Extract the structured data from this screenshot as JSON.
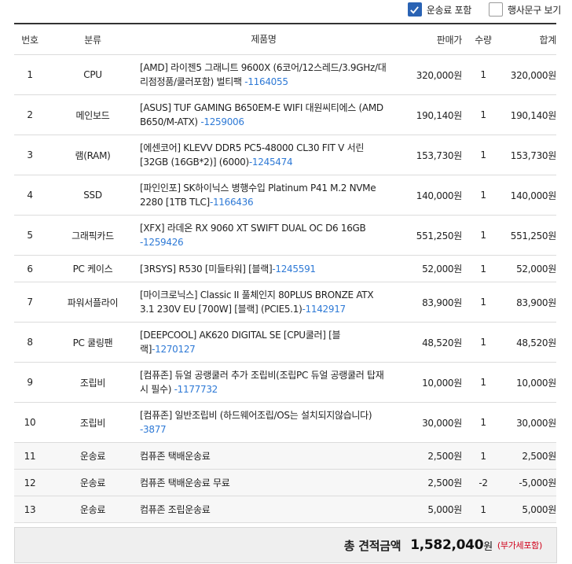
{
  "options": {
    "shipping": {
      "label": "운송료 포함",
      "checked": true
    },
    "promo": {
      "label": "행사문구 보기",
      "checked": false
    }
  },
  "table": {
    "headers": {
      "no": "번호",
      "category": "분류",
      "name": "제품명",
      "price": "판매가",
      "qty": "수량",
      "total": "합계"
    },
    "rows": [
      {
        "no": "1",
        "category": "CPU",
        "name": "[AMD] 라이젠5 그래니트 9600X (6코어/12스레드/3.9GHz/대리점정품/쿨러포함) 벌티팩 ",
        "code": "-1164055",
        "price": "320,000원",
        "qty": "1",
        "total": "320,000원"
      },
      {
        "no": "2",
        "category": "메인보드",
        "name": "[ASUS] TUF GAMING B650EM-E WIFI 대원씨티에스 (AMD B650/M-ATX) ",
        "code": "-1259006",
        "price": "190,140원",
        "qty": "1",
        "total": "190,140원"
      },
      {
        "no": "3",
        "category": "램(RAM)",
        "name": "[에센코어] KLEVV DDR5 PC5-48000 CL30 FIT V 서린 [32GB (16GB*2)] (6000)",
        "code": "-1245474",
        "price": "153,730원",
        "qty": "1",
        "total": "153,730원"
      },
      {
        "no": "4",
        "category": "SSD",
        "name": "[파인인포] SK하이닉스 병행수입 Platinum P41 M.2 NVMe 2280 [1TB TLC]",
        "code": "-1166436",
        "price": "140,000원",
        "qty": "1",
        "total": "140,000원"
      },
      {
        "no": "5",
        "category": "그래픽카드",
        "name": "[XFX] 라데온 RX 9060 XT SWIFT DUAL OC D6 16GB ",
        "code": "-1259426",
        "price": "551,250원",
        "qty": "1",
        "total": "551,250원"
      },
      {
        "no": "6",
        "category": "PC 케이스",
        "name": "[3RSYS] R530 [미들타워] [블랙]",
        "code": "-1245591",
        "price": "52,000원",
        "qty": "1",
        "total": "52,000원"
      },
      {
        "no": "7",
        "category": "파워서플라이",
        "name": "[마이크로닉스] Classic II 풀체인지 80PLUS BRONZE ATX 3.1 230V EU [700W] [블랙] (PCIE5.1)",
        "code": "-1142917",
        "price": "83,900원",
        "qty": "1",
        "total": "83,900원"
      },
      {
        "no": "8",
        "category": "PC 쿨링팬",
        "name": "[DEEPCOOL] AK620 DIGITAL SE [CPU쿨러] [블랙]",
        "code": "-1270127",
        "price": "48,520원",
        "qty": "1",
        "total": "48,520원"
      },
      {
        "no": "9",
        "category": "조립비",
        "name": "[컴퓨존] 듀얼 공랭쿨러 추가 조립비(조립PC 듀얼 공랭쿨러 탑재 시 필수) ",
        "code": "-1177732",
        "price": "10,000원",
        "qty": "1",
        "total": "10,000원"
      },
      {
        "no": "10",
        "category": "조립비",
        "name": "[컴퓨존] 일반조립비 (하드웨어조립/OS는 설치되지않습니다) ",
        "code": "-3877",
        "price": "30,000원",
        "qty": "1",
        "total": "30,000원"
      },
      {
        "no": "11",
        "category": "운송료",
        "name": "컴퓨존 택배운송료",
        "code": "",
        "price": "2,500원",
        "qty": "1",
        "total": "2,500원"
      },
      {
        "no": "12",
        "category": "운송료",
        "name": "컴퓨존 택배운송료 무료",
        "code": "",
        "price": "2,500원",
        "qty": "-2",
        "total": "-5,000원"
      },
      {
        "no": "13",
        "category": "운송료",
        "name": "컴퓨존 조립운송료",
        "code": "",
        "price": "5,000원",
        "qty": "1",
        "total": "5,000원"
      }
    ]
  },
  "summary": {
    "label": "총 견적금액",
    "amount": "1,582,040",
    "unit": "원",
    "note": "(부가세포함)"
  },
  "colors": {
    "accent": "#2a63b4",
    "link": "#2f7ad6",
    "note": "#d0021b"
  }
}
